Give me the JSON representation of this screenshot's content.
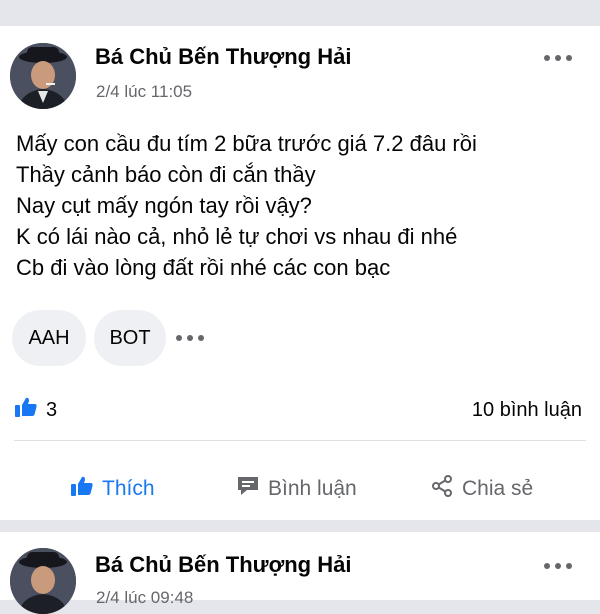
{
  "posts": [
    {
      "author": "Bá Chủ Bến Thượng Hải",
      "time": "2/4 lúc 11:05",
      "lines": [
        "Mấy con cầu đu tím 2 bữa trước giá 7.2 đâu rồi",
        "Thầy cảnh báo còn đi cắn thầy",
        "Nay cụt mấy ngón tay rồi vậy?",
        "K có lái nào cả, nhỏ lẻ tự chơi vs nhau đi nhé",
        "Cb đi vào lòng đất rồi nhé các con bạc"
      ],
      "tags": [
        "AAH",
        "BOT"
      ],
      "likes": "3",
      "comments": "10 bình luận",
      "actions": {
        "like": "Thích",
        "comment": "Bình luận",
        "share": "Chia sẻ"
      }
    },
    {
      "author": "Bá Chủ Bến Thượng Hải",
      "time": "2/4 lúc 09:48"
    }
  ],
  "icons": {
    "more": "more-dots-icon",
    "like_reaction": "thumbs-up-icon",
    "comment": "comment-icon",
    "share": "share-icon"
  },
  "colors": {
    "accent": "#1877f2",
    "secondary_text": "#65676b",
    "background": "#e4e6eb",
    "chip": "#eef0f3"
  }
}
